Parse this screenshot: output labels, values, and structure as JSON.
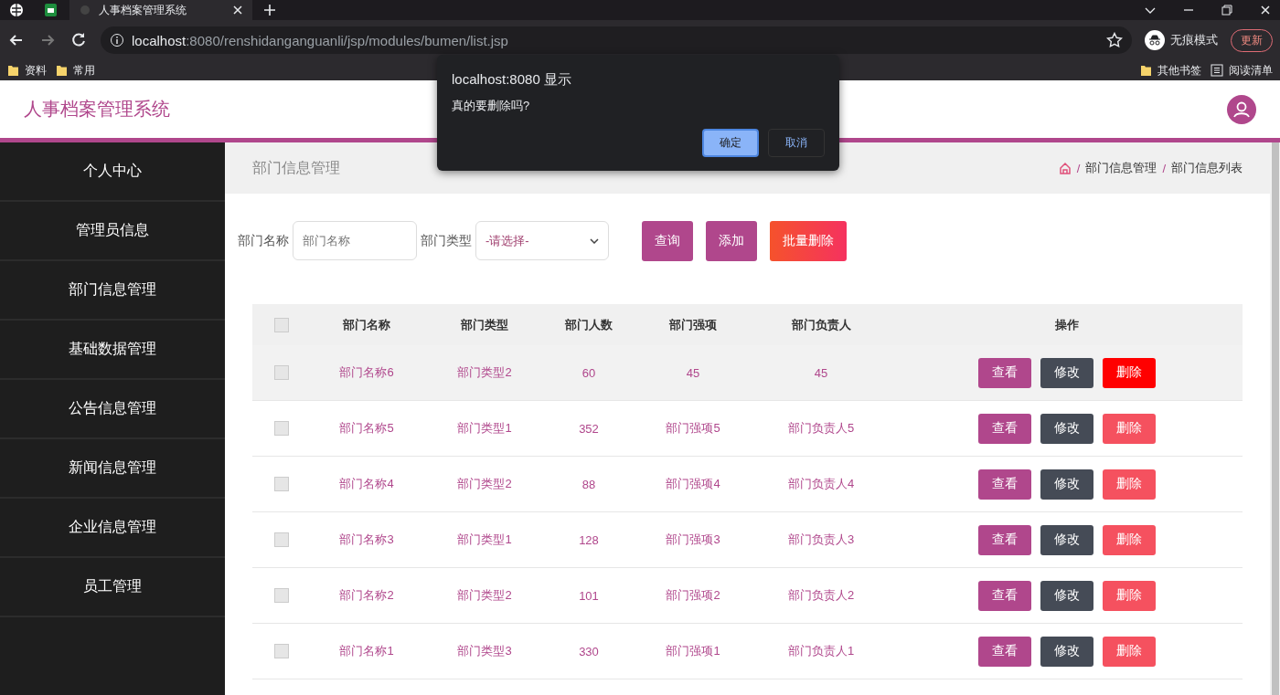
{
  "browser": {
    "tab_title": "人事档案管理系统",
    "url_host": "localhost",
    "url_rest": ":8080/renshidanganguanli/jsp/modules/bumen/list.jsp",
    "incognito_label": "无痕模式",
    "update_label": "更新",
    "bookmarks": [
      {
        "label": "资料"
      },
      {
        "label": "常用"
      }
    ],
    "other_bookmarks": "其他书签",
    "reading_list": "阅读清单"
  },
  "app": {
    "title": "人事档案管理系统"
  },
  "sidebar": {
    "items": [
      {
        "label": "个人中心",
        "selected": false
      },
      {
        "label": "管理员信息",
        "selected": false
      },
      {
        "label": "部门信息管理",
        "selected": false
      },
      {
        "label": "基础数据管理",
        "selected": false
      },
      {
        "label": "公告信息管理",
        "selected": false
      },
      {
        "label": "新闻信息管理",
        "selected": false
      },
      {
        "label": "企业信息管理",
        "selected": false
      },
      {
        "label": "员工管理",
        "selected": false
      }
    ]
  },
  "page": {
    "title": "部门信息管理",
    "breadcrumb": [
      {
        "separator": "/",
        "label": "部门信息管理"
      },
      {
        "separator": "/",
        "label": "部门信息列表"
      }
    ]
  },
  "search": {
    "name_label": "部门名称",
    "name_placeholder": "部门名称",
    "type_label": "部门类型",
    "type_value": "-请选择-",
    "buttons": [
      {
        "label": "查询",
        "kind": "primary"
      },
      {
        "label": "添加",
        "kind": "primary"
      },
      {
        "label": "批量删除",
        "kind": "danger"
      }
    ]
  },
  "table": {
    "all_checked": false,
    "columns": [
      "部门名称",
      "部门类型",
      "部门人数",
      "部门强项",
      "部门负责人",
      "操作"
    ],
    "rows": [
      {
        "cells": [
          "部门名称6",
          "部门类型2",
          "60",
          "45",
          "45"
        ],
        "checked": false,
        "hovered": true,
        "actions": [
          {
            "label": "查看",
            "kind": "view"
          },
          {
            "label": "修改",
            "kind": "edit"
          },
          {
            "label": "删除",
            "kind": "delete"
          }
        ]
      },
      {
        "cells": [
          "部门名称5",
          "部门类型1",
          "352",
          "部门强项5",
          "部门负责人5"
        ],
        "checked": false,
        "hovered": false,
        "actions": [
          {
            "label": "查看",
            "kind": "view"
          },
          {
            "label": "修改",
            "kind": "edit"
          },
          {
            "label": "删除",
            "kind": "delete"
          }
        ]
      },
      {
        "cells": [
          "部门名称4",
          "部门类型2",
          "88",
          "部门强项4",
          "部门负责人4"
        ],
        "checked": false,
        "hovered": false,
        "actions": [
          {
            "label": "查看",
            "kind": "view"
          },
          {
            "label": "修改",
            "kind": "edit"
          },
          {
            "label": "删除",
            "kind": "delete"
          }
        ]
      },
      {
        "cells": [
          "部门名称3",
          "部门类型1",
          "128",
          "部门强项3",
          "部门负责人3"
        ],
        "checked": false,
        "hovered": false,
        "actions": [
          {
            "label": "查看",
            "kind": "view"
          },
          {
            "label": "修改",
            "kind": "edit"
          },
          {
            "label": "删除",
            "kind": "delete"
          }
        ]
      },
      {
        "cells": [
          "部门名称2",
          "部门类型2",
          "101",
          "部门强项2",
          "部门负责人2"
        ],
        "checked": false,
        "hovered": false,
        "actions": [
          {
            "label": "查看",
            "kind": "view"
          },
          {
            "label": "修改",
            "kind": "edit"
          },
          {
            "label": "删除",
            "kind": "delete"
          }
        ]
      },
      {
        "cells": [
          "部门名称1",
          "部门类型3",
          "330",
          "部门强项1",
          "部门负责人1"
        ],
        "checked": false,
        "hovered": false,
        "actions": [
          {
            "label": "查看",
            "kind": "view"
          },
          {
            "label": "修改",
            "kind": "edit"
          },
          {
            "label": "删除",
            "kind": "delete"
          }
        ]
      }
    ]
  },
  "dialog": {
    "title": "localhost:8080 显示",
    "message": "真的要删除吗?",
    "ok": "确定",
    "cancel": "取消"
  }
}
